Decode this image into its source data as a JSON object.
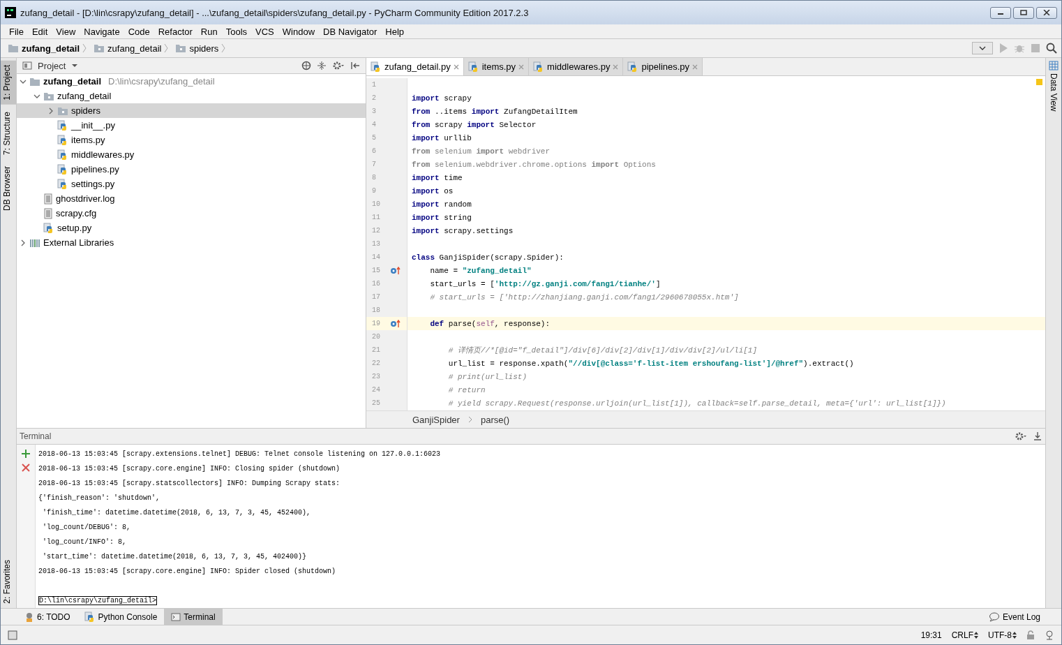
{
  "window": {
    "title": "zufang_detail - [D:\\lin\\csrapy\\zufang_detail] - ...\\zufang_detail\\spiders\\zufang_detail.py - PyCharm Community Edition 2017.2.3"
  },
  "menu": [
    {
      "label": "File"
    },
    {
      "label": "Edit"
    },
    {
      "label": "View"
    },
    {
      "label": "Navigate"
    },
    {
      "label": "Code"
    },
    {
      "label": "Refactor"
    },
    {
      "label": "Run"
    },
    {
      "label": "Tools"
    },
    {
      "label": "VCS"
    },
    {
      "label": "Window"
    },
    {
      "label": "DB Navigator"
    },
    {
      "label": "Help"
    }
  ],
  "breadcrumb": [
    {
      "label": "zufang_detail",
      "kind": "project"
    },
    {
      "label": "zufang_detail",
      "kind": "folder"
    },
    {
      "label": "spiders",
      "kind": "folder"
    }
  ],
  "left_stripe": [
    {
      "label": "1: Project",
      "selected": true
    },
    {
      "label": "7: Structure",
      "selected": false
    },
    {
      "label": "DB Browser",
      "selected": false
    }
  ],
  "left_stripe_bottom": [
    {
      "label": "2: Favorites",
      "selected": false
    }
  ],
  "project_panel": {
    "title": "Project",
    "tree": [
      {
        "label": "zufang_detail",
        "path": "D:\\lin\\csrapy\\zufang_detail",
        "kind": "project",
        "expanded": true,
        "selected": false,
        "children": [
          {
            "label": "zufang_detail",
            "kind": "package",
            "expanded": true,
            "selected": false,
            "children": [
              {
                "label": "spiders",
                "kind": "package",
                "expanded": false,
                "selected": true
              },
              {
                "label": "__init__.py",
                "kind": "python",
                "selected": false
              },
              {
                "label": "items.py",
                "kind": "python",
                "selected": false
              },
              {
                "label": "middlewares.py",
                "kind": "python",
                "selected": false
              },
              {
                "label": "pipelines.py",
                "kind": "python",
                "selected": false
              },
              {
                "label": "settings.py",
                "kind": "python",
                "selected": false
              }
            ]
          },
          {
            "label": "ghostdriver.log",
            "kind": "text",
            "selected": false
          },
          {
            "label": "scrapy.cfg",
            "kind": "text",
            "selected": false
          },
          {
            "label": "setup.py",
            "kind": "python",
            "selected": false
          }
        ]
      },
      {
        "label": "External Libraries",
        "kind": "library",
        "expanded": false,
        "selected": false
      }
    ]
  },
  "editor_tabs": [
    {
      "label": "zufang_detail.py",
      "selected": true
    },
    {
      "label": "items.py",
      "selected": false
    },
    {
      "label": "middlewares.py",
      "selected": false
    },
    {
      "label": "pipelines.py",
      "selected": false
    }
  ],
  "code": [
    {
      "number": "1",
      "current": false
    },
    {
      "number": "2",
      "current": false,
      "tokens": [
        {
          "kind": "kw",
          "text": "import"
        },
        {
          "kind": "plain",
          "text": " scrapy"
        }
      ]
    },
    {
      "number": "3",
      "current": false,
      "tokens": [
        {
          "kind": "kw",
          "text": "from"
        },
        {
          "kind": "plain",
          "text": " ..items "
        },
        {
          "kind": "kw",
          "text": "import"
        },
        {
          "kind": "plain",
          "text": " ZufangDetailItem"
        }
      ]
    },
    {
      "number": "4",
      "current": false,
      "tokens": [
        {
          "kind": "kw",
          "text": "from"
        },
        {
          "kind": "plain",
          "text": " scrapy "
        },
        {
          "kind": "kw",
          "text": "import"
        },
        {
          "kind": "plain",
          "text": " Selector"
        }
      ]
    },
    {
      "number": "5",
      "current": false,
      "tokens": [
        {
          "kind": "kw",
          "text": "import"
        },
        {
          "kind": "plain",
          "text": " urllib"
        }
      ]
    },
    {
      "number": "6",
      "current": false,
      "tokens": [
        {
          "kind": "dimkw",
          "text": "from"
        },
        {
          "kind": "dim",
          "text": " selenium "
        },
        {
          "kind": "dimkw",
          "text": "import"
        },
        {
          "kind": "dim",
          "text": " webdriver"
        }
      ]
    },
    {
      "number": "7",
      "current": false,
      "tokens": [
        {
          "kind": "dimkw",
          "text": "from"
        },
        {
          "kind": "dim",
          "text": " selenium.webdriver.chrome.options "
        },
        {
          "kind": "dimkw",
          "text": "import"
        },
        {
          "kind": "dim",
          "text": " Options"
        }
      ]
    },
    {
      "number": "8",
      "current": false,
      "tokens": [
        {
          "kind": "kw",
          "text": "import"
        },
        {
          "kind": "plain",
          "text": " time"
        }
      ]
    },
    {
      "number": "9",
      "current": false,
      "tokens": [
        {
          "kind": "kw",
          "text": "import"
        },
        {
          "kind": "plain",
          "text": " os"
        }
      ]
    },
    {
      "number": "10",
      "current": false,
      "tokens": [
        {
          "kind": "kw",
          "text": "import"
        },
        {
          "kind": "plain",
          "text": " random"
        }
      ]
    },
    {
      "number": "11",
      "current": false,
      "tokens": [
        {
          "kind": "kw",
          "text": "import"
        },
        {
          "kind": "plain",
          "text": " string"
        }
      ]
    },
    {
      "number": "12",
      "current": false,
      "tokens": [
        {
          "kind": "kw",
          "text": "import"
        },
        {
          "kind": "plain",
          "text": " scrapy.settings"
        }
      ]
    },
    {
      "number": "13",
      "current": false
    },
    {
      "number": "14",
      "current": false,
      "tokens": [
        {
          "kind": "kw",
          "text": "class"
        },
        {
          "kind": "plain",
          "text": " GanjiSpider(scrapy.Spider):"
        }
      ]
    },
    {
      "number": "15",
      "current": false,
      "override": true,
      "tokens": [
        {
          "kind": "plain",
          "text": "    name = "
        },
        {
          "kind": "str",
          "text": "\"zufang_detail\""
        }
      ]
    },
    {
      "number": "16",
      "current": false,
      "tokens": [
        {
          "kind": "plain",
          "text": "    start_urls = ["
        },
        {
          "kind": "str",
          "text": "'http://gz.ganji.com/fang1/tianhe/'"
        },
        {
          "kind": "plain",
          "text": "]"
        }
      ]
    },
    {
      "number": "17",
      "current": false,
      "tokens": [
        {
          "kind": "comment",
          "text": "    # start_urls = ['http://zhanjiang.ganji.com/fang1/2960678055x.htm']"
        }
      ]
    },
    {
      "number": "18",
      "current": false
    },
    {
      "number": "19",
      "current": true,
      "override": true,
      "tokens": [
        {
          "kind": "kw",
          "text": "    def"
        },
        {
          "kind": "plain",
          "text": " parse("
        },
        {
          "kind": "self",
          "text": "self"
        },
        {
          "kind": "plain",
          "text": ", response):"
        }
      ]
    },
    {
      "number": "20",
      "current": false
    },
    {
      "number": "21",
      "current": false,
      "tokens": [
        {
          "kind": "comment",
          "text": "        # 详情页//*[@id=\"f_detail\"]/div[6]/div[2]/div[1]/div/div[2]/ul/li[1]"
        }
      ]
    },
    {
      "number": "22",
      "current": false,
      "tokens": [
        {
          "kind": "plain",
          "text": "        url_list = response.xpath("
        },
        {
          "kind": "str",
          "text": "\"//div[@class='f-list-item ershoufang-list']/@href\""
        },
        {
          "kind": "plain",
          "text": ").extract()"
        }
      ]
    },
    {
      "number": "23",
      "current": false,
      "tokens": [
        {
          "kind": "comment",
          "text": "        # print(url_list)"
        }
      ]
    },
    {
      "number": "24",
      "current": false,
      "tokens": [
        {
          "kind": "comment",
          "text": "        # return"
        }
      ]
    },
    {
      "number": "25",
      "current": false,
      "tokens": [
        {
          "kind": "comment",
          "text": "        # yield scrapy.Request(response.urljoin(url_list[1]), callback=self.parse_detail, meta={'url': url_list[1]})"
        }
      ]
    }
  ],
  "editor_breadcrumb": [
    "GanjiSpider",
    "parse()"
  ],
  "right_stripe": [
    {
      "label": "Data View",
      "selected": false
    }
  ],
  "terminal": {
    "title": "Terminal",
    "lines": [
      "2018-06-13 15:03:45 [scrapy.extensions.telnet] DEBUG: Telnet console listening on 127.0.0.1:6023",
      "2018-06-13 15:03:45 [scrapy.core.engine] INFO: Closing spider (shutdown)",
      "2018-06-13 15:03:45 [scrapy.statscollectors] INFO: Dumping Scrapy stats:",
      "{'finish_reason': 'shutdown',",
      " 'finish_time': datetime.datetime(2018, 6, 13, 7, 3, 45, 452400),",
      " 'log_count/DEBUG': 8,",
      " 'log_count/INFO': 8,",
      " 'start_time': datetime.datetime(2018, 6, 13, 7, 3, 45, 402400)}",
      "2018-06-13 15:03:45 [scrapy.core.engine] INFO: Spider closed (shutdown)"
    ],
    "prompt": "D:\\lin\\csrapy\\zufang_detail>"
  },
  "tool_tabs": [
    {
      "label": "6: TODO",
      "kind": "todo",
      "selected": false
    },
    {
      "label": "Python Console",
      "kind": "python",
      "selected": false
    },
    {
      "label": "Terminal",
      "kind": "terminal",
      "selected": true
    }
  ],
  "event_log": "Event Log",
  "status": {
    "position": "19:31",
    "line_separator": "CRLF",
    "encoding": "UTF-8"
  }
}
